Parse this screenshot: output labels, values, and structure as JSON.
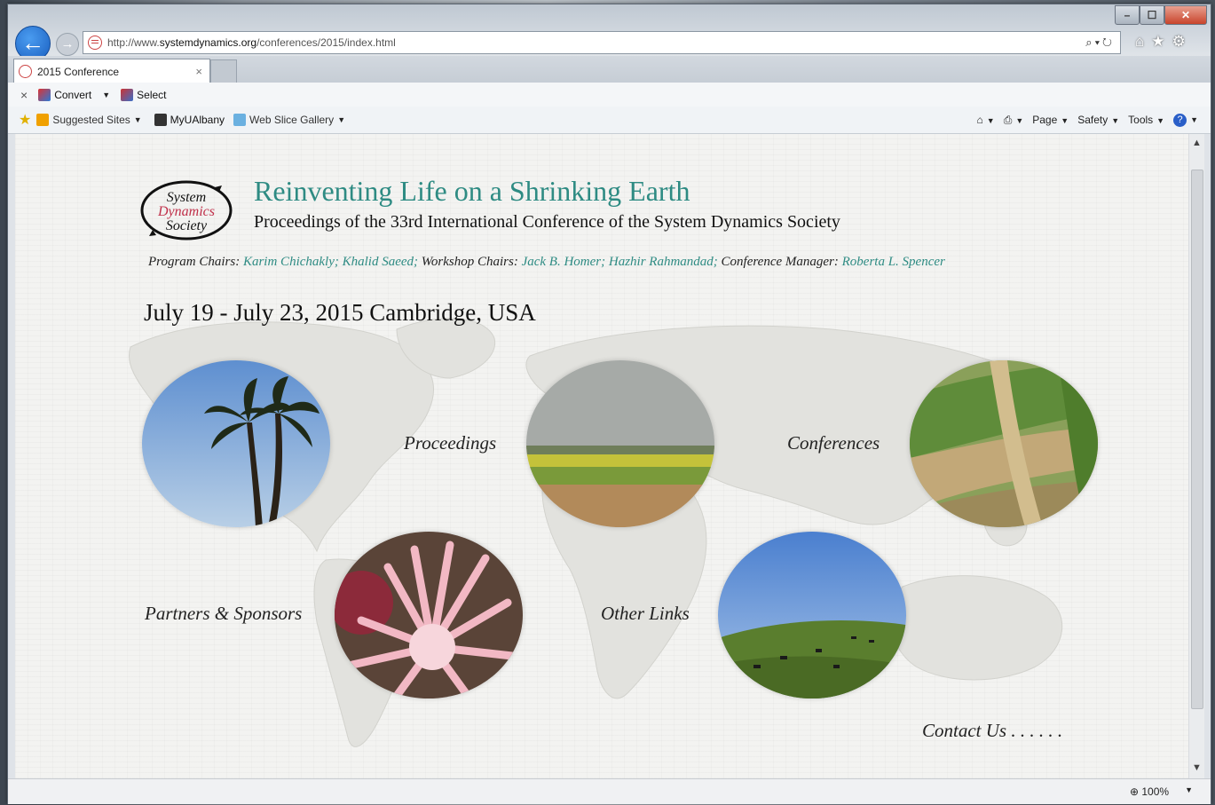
{
  "browser": {
    "address_url_prefix": "http://www.",
    "address_url_domain": "systemdynamics.org",
    "address_url_path": "/conferences/2015/index.html",
    "tab_title": "2015 Conference",
    "tab_close": "×",
    "command_bar": {
      "close": "×",
      "convert_label": "Convert",
      "select_label": "Select"
    },
    "favorites_bar": {
      "suggested_sites": "Suggested Sites",
      "myualbany": "MyUAlbany",
      "web_slice_gallery": "Web Slice Gallery"
    },
    "toolbar_right": {
      "page": "Page",
      "safety": "Safety",
      "tools": "Tools"
    },
    "zoom_level": "100%",
    "window_buttons": {
      "min": "–",
      "max": "☐",
      "close": "✕"
    }
  },
  "page": {
    "logo_text": [
      "System",
      "Dynamics",
      "Society"
    ],
    "title": "Reinventing Life on a Shrinking Earth",
    "subtitle": "Proceedings of the 33rd International Conference of the System Dynamics Society",
    "chairs": {
      "program_label": "Program Chairs:",
      "program_names": "Karim Chichakly; Khalid Saeed;",
      "workshop_label": "Workshop Chairs:",
      "workshop_names": "Jack B. Homer; Hazhir Rahmandad;",
      "manager_label": "Conference Manager:",
      "manager_name": "Roberta L. Spencer"
    },
    "date_location": "July 19 - July 23, 2015 Cambridge, USA",
    "nav_links": {
      "proceedings": "Proceedings",
      "conferences": "Conferences",
      "partners": "Partners & Sponsors",
      "other_links": "Other Links",
      "contact": "Contact Us . . . . . ."
    },
    "colors": {
      "accent": "#2e8b83",
      "logo_red": "#c0304a"
    }
  }
}
